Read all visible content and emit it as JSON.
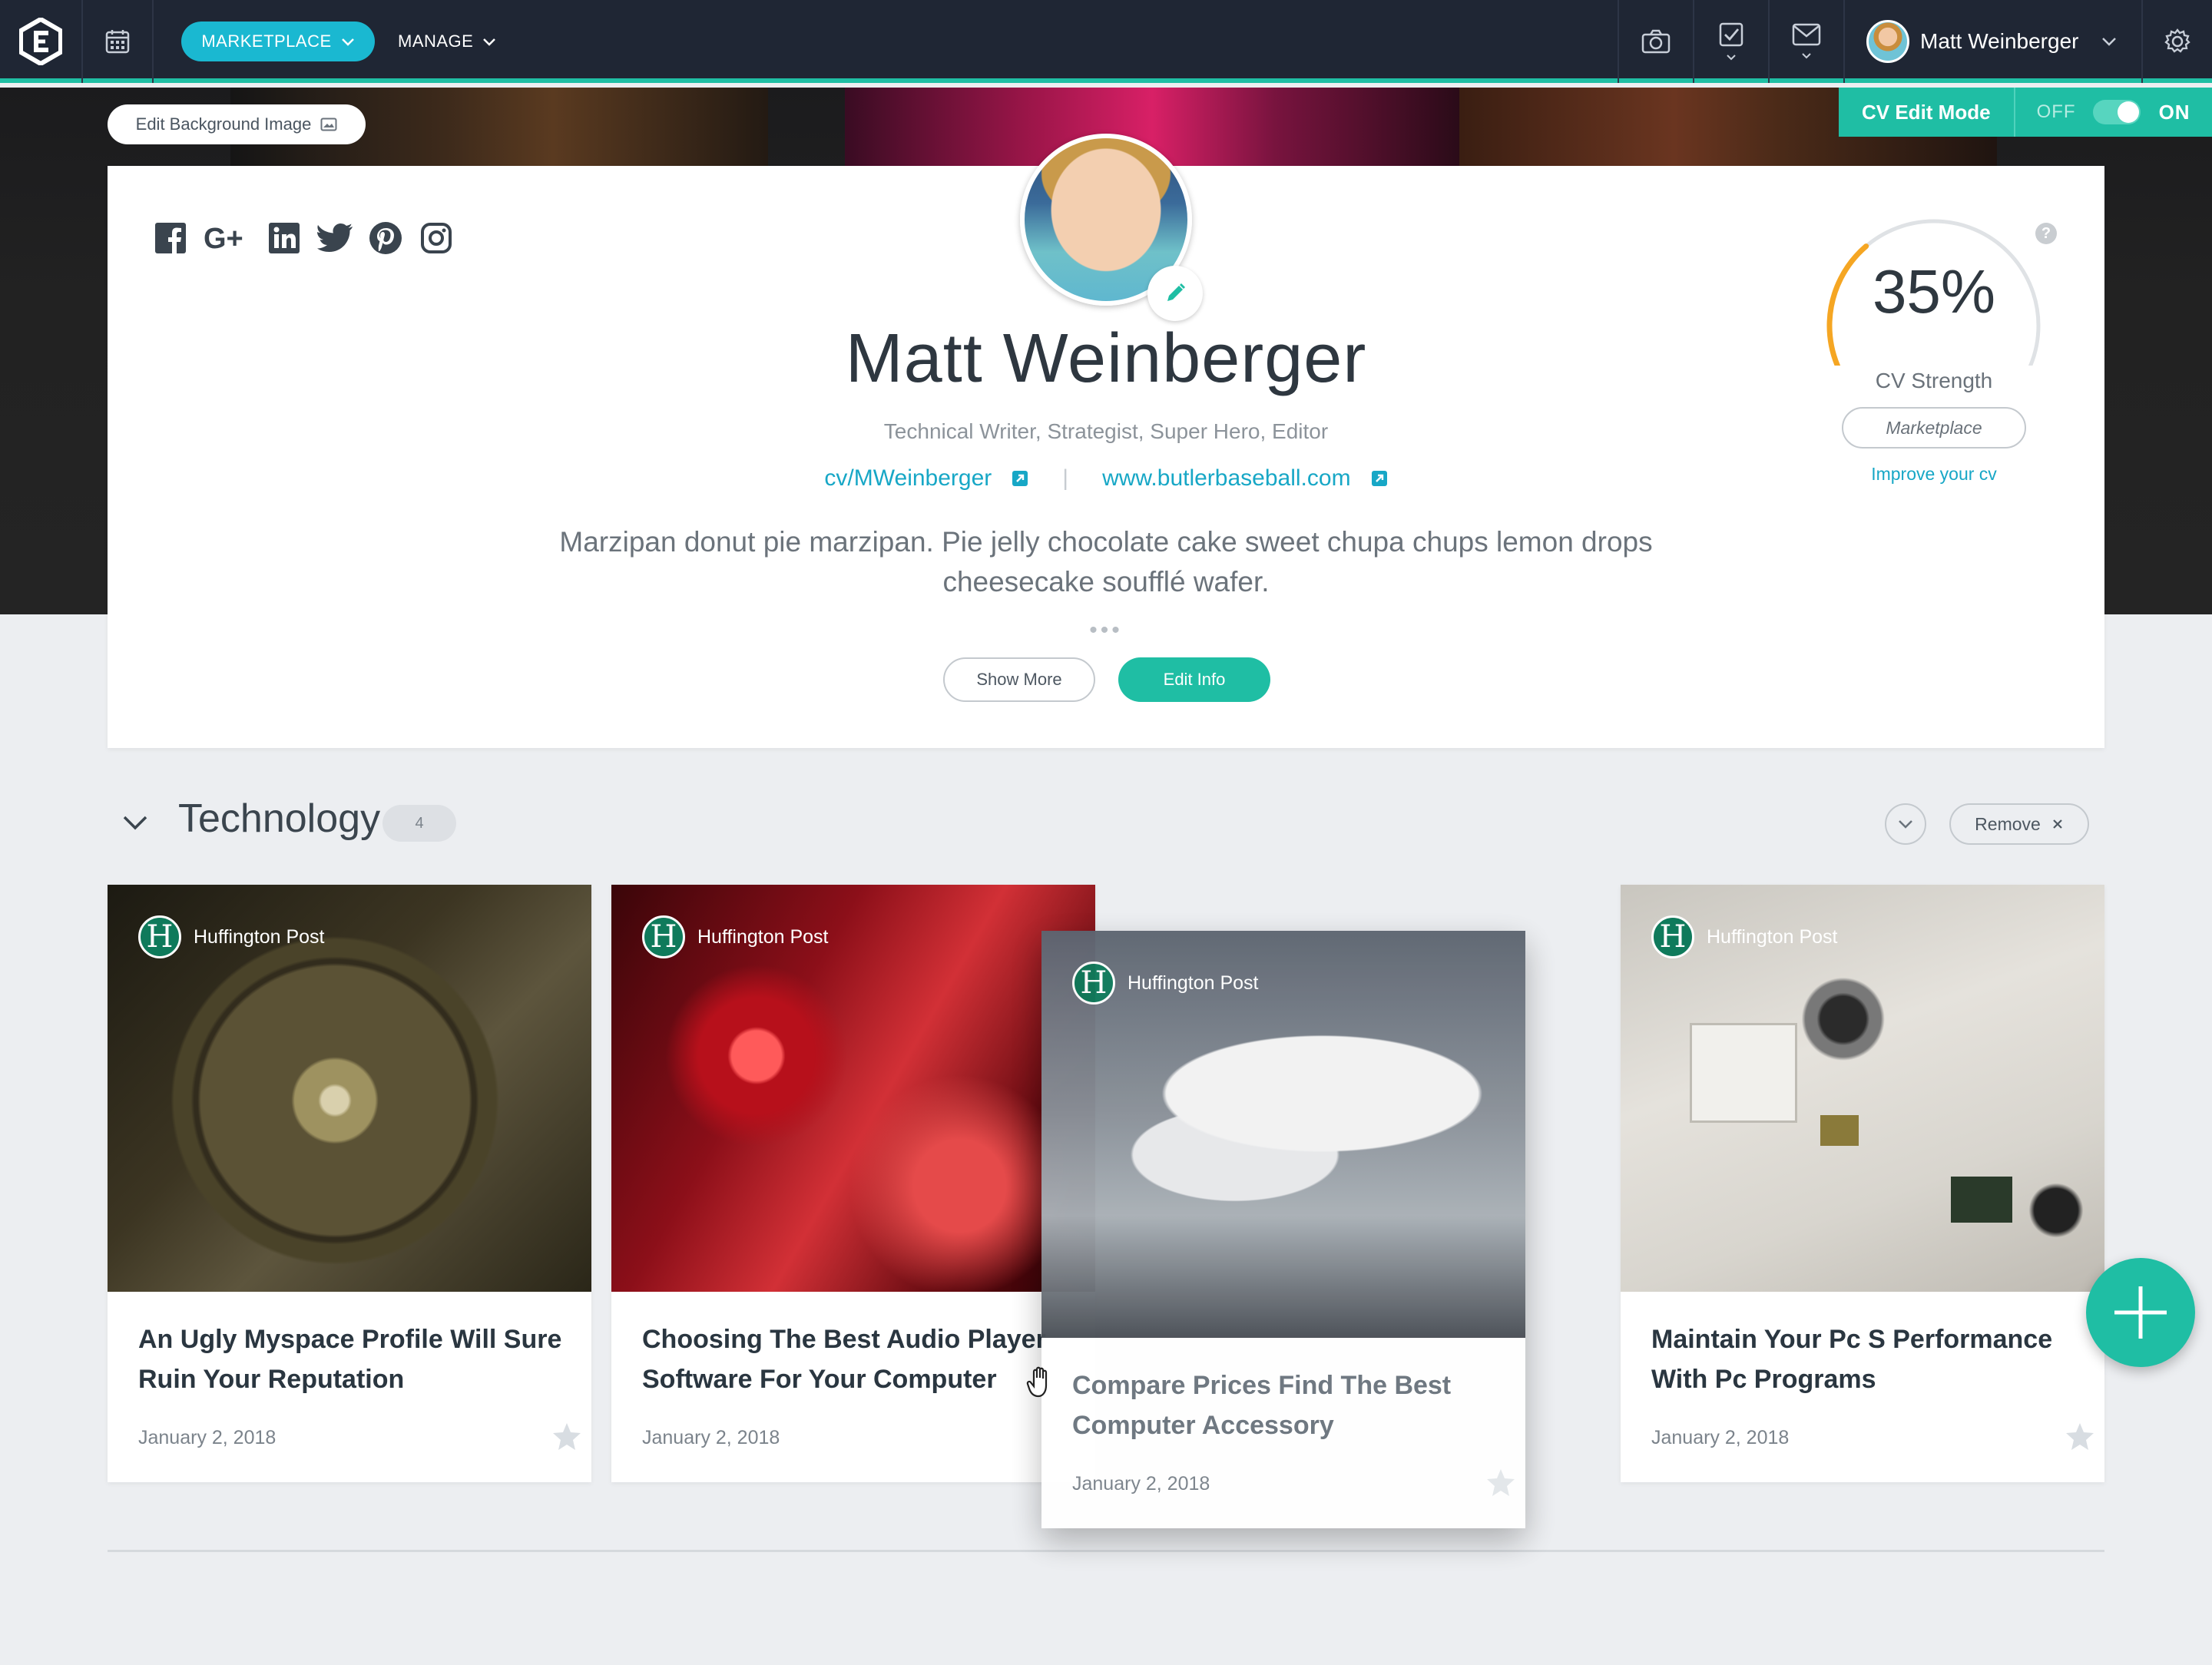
{
  "nav": {
    "marketplace_label": "MARKETPLACE",
    "manage_label": "MANAGE",
    "user_name": "Matt Weinberger"
  },
  "hero": {
    "edit_background_label": "Edit Background Image",
    "cv_edit_mode_label": "CV Edit Mode",
    "toggle_off": "OFF",
    "toggle_on": "ON"
  },
  "profile": {
    "social_icons": [
      "facebook-icon",
      "google-plus-icon",
      "linkedin-icon",
      "twitter-icon",
      "pinterest-icon",
      "instagram-icon"
    ],
    "name": "Matt Weinberger",
    "title": "Technical Writer, Strategist, Super Hero, Editor",
    "link_cv": "cv/MWeinberger",
    "link_site": "www.butlerbaseball.com",
    "bio": "Marzipan donut pie marzipan. Pie jelly chocolate cake sweet chupa chups lemon drops cheesecake soufflé wafer.",
    "show_more_label": "Show More",
    "edit_info_label": "Edit Info",
    "strength_percent": "35%",
    "strength_value": 0.35,
    "strength_label": "CV Strength",
    "marketplace_btn": "Marketplace",
    "improve_link": "Improve your cv"
  },
  "section": {
    "title": "Technology",
    "count": "4",
    "remove_label": "Remove"
  },
  "cards": [
    {
      "source": "Huffington Post",
      "title": "An Ugly Myspace Profile Will Sure Ruin Your Reputation",
      "date": "January 2, 2018"
    },
    {
      "source": "Huffington Post",
      "title": "Choosing The Best Audio Player Software For Your Computer",
      "date": "January 2, 2018"
    },
    {
      "source": "Huffington Post",
      "title": "Compare Prices Find The Best Computer Accessory",
      "date": "January 2, 2018"
    },
    {
      "source": "Huffington Post",
      "title": "Maintain Your Pc S Performance With Pc Programs",
      "date": "January 2, 2018"
    }
  ],
  "colors": {
    "nav_bg": "#1f2634",
    "accent_teal": "#1fbea4",
    "accent_cyan": "#1ab8d1",
    "gauge_orange": "#f5a623",
    "link_blue": "#17a7c6"
  }
}
